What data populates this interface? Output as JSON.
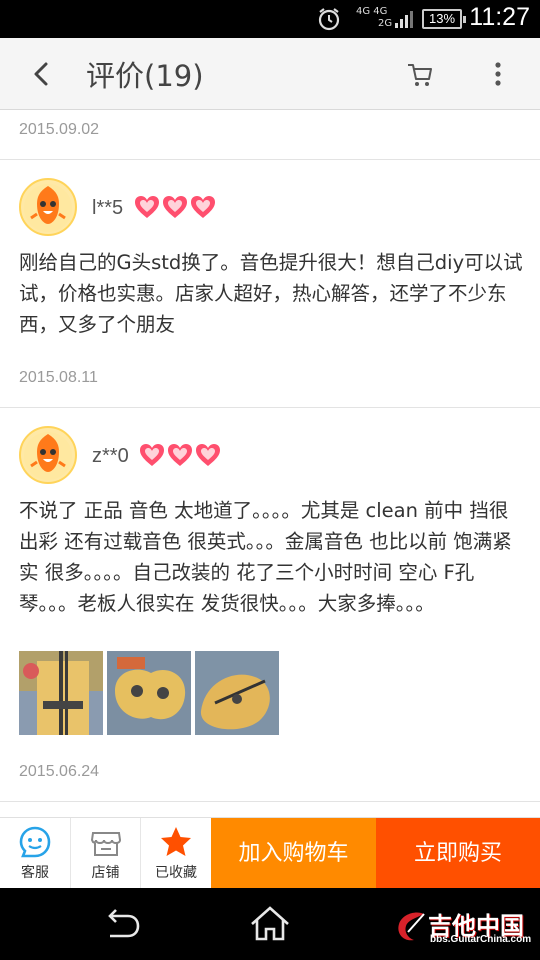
{
  "status_bar": {
    "time": "11:27",
    "battery": "13%",
    "network_top": "4G 4G",
    "network_bottom": "2G"
  },
  "header": {
    "title": "评价(19)"
  },
  "reviews": [
    {
      "date": "2015.09.02"
    },
    {
      "user": "l**5",
      "content": "刚给自己的G头std换了。音色提升很大！想自己diy可以试试，价格也实惠。店家人超好，热心解答，还学了不少东西，又多了个朋友",
      "date": "2015.08.11"
    },
    {
      "user": "z**0",
      "content": "不说了 正品 音色 太地道了。。。。尤其是 clean 前中 挡很出彩 还有过载音色  很英式。。。金属音色 也比以前 饱满紧实 很多。。。。自己改装的 花了三个小时时间 空心 F孔琴。。。老板人很实在 发货很快。。。大家多捧。。。",
      "date": "2015.06.24"
    }
  ],
  "bottom_bar": {
    "service_label": "客服",
    "shop_label": "店铺",
    "favorite_label": "已收藏",
    "add_cart_label": "加入购物车",
    "buy_now_label": "立即购买"
  },
  "watermark": {
    "name": "吉他中国",
    "url": "bbs.GuitarChina.com"
  },
  "colors": {
    "accent_orange": "#ff8a00",
    "buy_red_orange": "#ff5000",
    "service_blue": "#27a3e8",
    "favorite_orange": "#ff5000",
    "heart_pink": "#ff4f6e"
  }
}
